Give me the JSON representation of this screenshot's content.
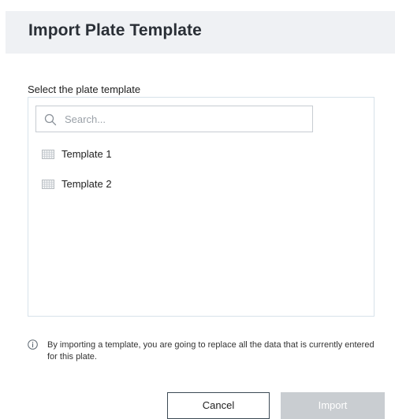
{
  "dialog": {
    "title": "Import Plate Template",
    "section_label": "Select the plate template",
    "search": {
      "placeholder": "Search...",
      "value": ""
    },
    "templates": [
      {
        "label": "Template 1",
        "icon": "plate-grid-icon"
      },
      {
        "label": "Template 2",
        "icon": "plate-grid-icon"
      }
    ],
    "notice": {
      "icon": "info-icon",
      "text": "By importing a template, you are going to replace all the data that is currently entered for this plate."
    },
    "buttons": {
      "cancel_label": "Cancel",
      "import_label": "Import",
      "import_enabled": false
    }
  },
  "colors": {
    "header_bg": "#eff1f4",
    "panel_border": "#d7e2ea",
    "import_disabled_bg": "#c9cdd1",
    "cancel_border": "#3c4a55"
  }
}
